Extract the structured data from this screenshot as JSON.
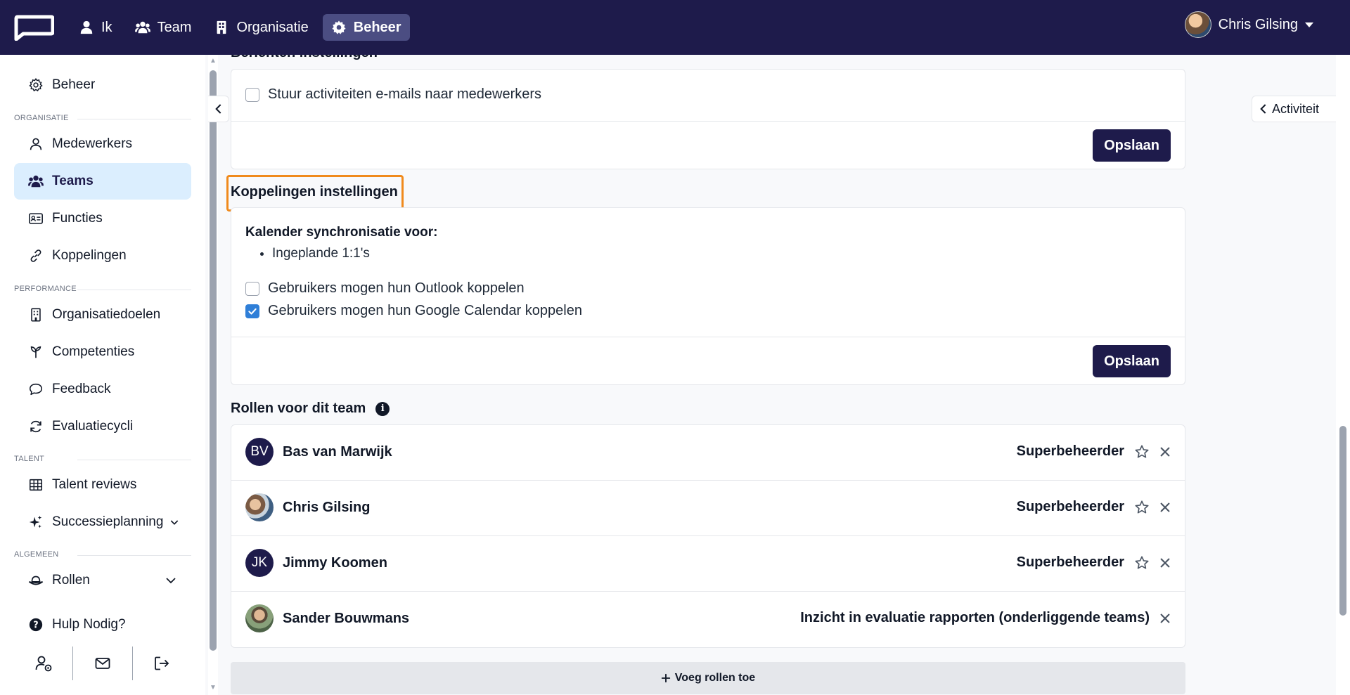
{
  "nav": {
    "items": [
      {
        "label": "Ik",
        "icon": "user-icon"
      },
      {
        "label": "Team",
        "icon": "users-icon"
      },
      {
        "label": "Organisatie",
        "icon": "building-icon"
      },
      {
        "label": "Beheer",
        "icon": "gear-icon",
        "active": true
      }
    ],
    "user_name": "Chris Gilsing"
  },
  "sidebar": {
    "top_item": "Beheer",
    "sections": {
      "organisatie": "ORGANISATIE",
      "performance": "PERFORMANCE",
      "talent": "TALENT",
      "algemeen": "ALGEMEEN"
    },
    "items": {
      "medewerkers": "Medewerkers",
      "teams": "Teams",
      "functies": "Functies",
      "koppelingen": "Koppelingen",
      "organisatiedoelen": "Organisatiedoelen",
      "competenties": "Competenties",
      "feedback": "Feedback",
      "evaluatiecycli": "Evaluatiecycli",
      "talent_reviews": "Talent reviews",
      "successieplanning": "Successieplanning",
      "rollen": "Rollen",
      "hulp": "Hulp Nodig?"
    }
  },
  "main": {
    "cut_title": "Berichten instellingen",
    "berichten": {
      "checkbox_label": "Stuur activiteiten e-mails naar medewerkers",
      "checked": false,
      "save_label": "Opslaan"
    },
    "koppelingen": {
      "title": "Koppelingen instellingen",
      "sync_title": "Kalender synchronisatie voor:",
      "sync_items": [
        "Ingeplande 1:1's"
      ],
      "outlook_label": "Gebruikers mogen hun Outlook koppelen",
      "outlook_checked": false,
      "google_label": "Gebruikers mogen hun Google Calendar koppelen",
      "google_checked": true,
      "save_label": "Opslaan"
    },
    "rollen": {
      "title": "Rollen voor dit team",
      "rows": [
        {
          "initials": "BV",
          "name": "Bas van Marwijk",
          "role": "Superbeheerder",
          "star": true
        },
        {
          "initials": "",
          "name": "Chris Gilsing",
          "role": "Superbeheerder",
          "star": true
        },
        {
          "initials": "JK",
          "name": "Jimmy Koomen",
          "role": "Superbeheerder",
          "star": true
        },
        {
          "initials": "",
          "name": "Sander Bouwmans",
          "role": "Inzicht in evaluatie rapporten (onderliggende teams)",
          "star": false
        }
      ],
      "add_label": "Voeg rollen toe"
    },
    "activity_label": "Activiteit"
  },
  "colors": {
    "nav_bg": "#1e1b4b",
    "active_nav": "#4b4d82",
    "sidebar_active_bg": "#dbeefe",
    "primary_button": "#1e1b4b",
    "checkbox_checked": "#2f7fd8",
    "highlight": "#f08a1c"
  }
}
